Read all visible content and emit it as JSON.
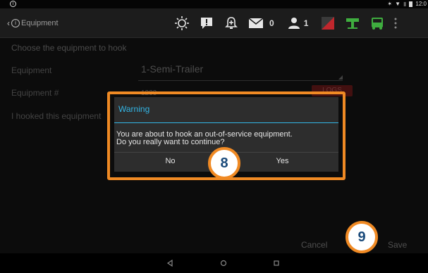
{
  "status_bar": {
    "info_glyph": "i",
    "bluetooth_glyph": "✶",
    "wifi_glyph": "▼",
    "signal_glyph": "▮",
    "time": "12:0"
  },
  "app_bar": {
    "back_glyph": "‹",
    "logo_glyph": "i",
    "title": "Equipment",
    "message_count": "0",
    "driver_count": "1"
  },
  "form": {
    "header": "Choose the equipment to hook",
    "equipment_label": "Equipment",
    "equipment_value": "1-Semi-Trailer",
    "equipment_number_label": "Equipment #",
    "equipment_number_value": "1233",
    "logs_button": "LOGS",
    "hooked_label": "I hooked this equipment"
  },
  "dialog": {
    "title": "Warning",
    "message_line1": "You are about to hook an out-of-service equipment.",
    "message_line2": "Do you really want to continue?",
    "no_label": "No",
    "yes_label": "Yes"
  },
  "actions": {
    "cancel_label": "Cancel",
    "save_label": "Save"
  },
  "steps": {
    "step_a": "8",
    "step_b": "9"
  },
  "colors": {
    "accent_blue": "#33b5e5",
    "highlight_orange": "#f08a24",
    "badge_text": "#1a4a7a"
  },
  "icons": {
    "toolbar": [
      "brightness-icon",
      "chat-alert-icon",
      "bell-icon",
      "mail-icon",
      "person-icon",
      "status-flag-icon",
      "truck-road-icon",
      "truck-icon",
      "overflow-icon"
    ],
    "nav": [
      "back-nav-icon",
      "home-nav-icon",
      "recents-nav-icon"
    ]
  }
}
